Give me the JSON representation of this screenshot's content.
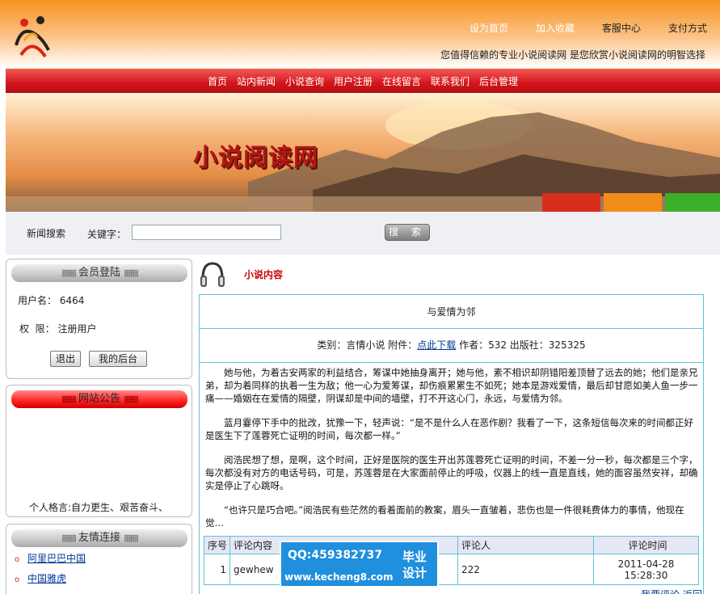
{
  "header": {
    "top_links": [
      "设为首页",
      "加入收藏",
      "客服中心",
      "支付方式"
    ],
    "slogan": "您值得信赖的专业小说阅读网 是您欣赏小说阅读网的明智选择"
  },
  "nav": [
    "首页",
    "站内新闻",
    "小说查询",
    "用户注册",
    "在线留言",
    "联系我们",
    "后台管理"
  ],
  "banner": {
    "title": "小说阅读网"
  },
  "search": {
    "label": "新闻搜索",
    "keyword_label": "关键字：",
    "keyword_value": "",
    "button": "搜 索"
  },
  "member": {
    "title": "会员登陆",
    "username_label": "用户名：",
    "username": "6464",
    "role_label": "权  限：",
    "role": "注册用户",
    "logout": "退出",
    "backend": "我的后台"
  },
  "notice": {
    "title": "网站公告",
    "motto": "个人格言:自力更生、艰苦奋斗、"
  },
  "friends": {
    "title": "友情连接",
    "items": [
      "阿里巴巴中国",
      "中国雅虎"
    ]
  },
  "content": {
    "section_title": "小说内容",
    "novel_title": "与爱情为邻",
    "meta_prefix": "类别：言情小说 附件：",
    "download_link": "点此下载",
    "meta_suffix": " 作者：532 出版社：325325",
    "paragraphs": [
      "她与他，为着古安两家的利益结合，筹谋中她抽身离开；她与他，素不相识却阴错阳差顶替了远去的她；他们是亲兄弟，却为着同样的执着一生为敌；他一心为爱筹谋，却伤痕累累生不如死；她本是游戏爱情，最后却甘愿如美人鱼一步一痛——婚姻在在爱情的隔壁，阴谋却是中间的墙壁，打不开这心门，永远，与爱情为邻。",
      "蓝月霎停下手中的批改，犹豫一下，轻声说：“是不是什么人在恶作剧？我看了一下，这条短信每次来的时间都正好是医生下了莲蓉死亡证明的时间，每次都一样。”",
      "阅浩民想了想，是啊，这个时间，正好是医院的医生开出苏莲蓉死亡证明的时间，不差一分一秒，每次都是三个字，每次都没有对方的电话号码，可是，苏莲蓉是在大家面前停止的呼吸，仪器上的线一直是直线，她的面容虽然安祥，却确实是停止了心跳呀。",
      "“也许只是巧合吧。”阅浩民有些茫然的看着面前的教案，眉头一直皱着，悲伤也是一件很耗费体力的事情，他现在觉…"
    ],
    "comments": {
      "headers": [
        "序号",
        "评论内容",
        "评论人",
        "评论时间"
      ],
      "rows": [
        {
          "index": "1",
          "text": "gewhew",
          "author": "222",
          "date": "2011-04-28",
          "time": "15:28:30"
        }
      ]
    },
    "bottom_link": "我要评论  返回"
  },
  "watermark": {
    "qq": "QQ:459382737",
    "url": "www.kecheng8.com",
    "tag": "毕业设计"
  }
}
